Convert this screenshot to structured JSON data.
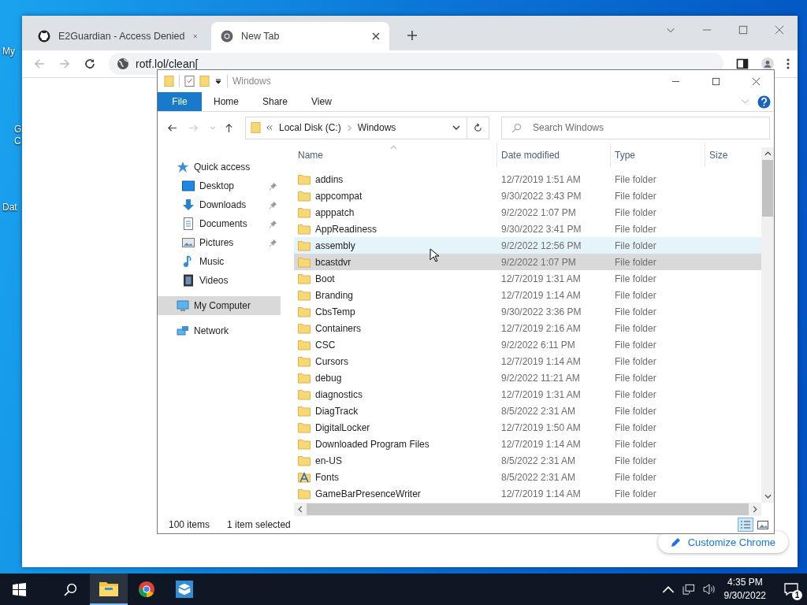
{
  "desktop_icons": [
    {
      "lines": [
        "My"
      ]
    },
    {
      "lines": [
        "G",
        "C"
      ]
    },
    {
      "lines": [
        "Dat"
      ]
    }
  ],
  "browser": {
    "tabs": [
      {
        "title": "E2Guardian - Access Denied",
        "selected": false
      },
      {
        "title": "New Tab",
        "selected": true
      }
    ],
    "address": "rotf.lol/clean[",
    "customize_button": "Customize Chrome"
  },
  "explorer": {
    "title": "Windows",
    "ribbon_tabs": [
      {
        "label": "File",
        "kind": "file"
      },
      {
        "label": "Home",
        "kind": "tab"
      },
      {
        "label": "Share",
        "kind": "tab"
      },
      {
        "label": "View",
        "kind": "tab"
      }
    ],
    "breadcrumb": [
      "Local Disk (C:)",
      "Windows"
    ],
    "search": {
      "placeholder": "Search Windows"
    },
    "nav": [
      {
        "label": "Quick access",
        "selected": false,
        "children": [
          {
            "label": "Desktop",
            "pinned": true,
            "selected": false
          },
          {
            "label": "Downloads",
            "pinned": true,
            "selected": false
          },
          {
            "label": "Documents",
            "pinned": true,
            "selected": false
          },
          {
            "label": "Pictures",
            "pinned": true,
            "selected": false
          },
          {
            "label": "Music",
            "pinned": false,
            "selected": false
          },
          {
            "label": "Videos",
            "pinned": false,
            "selected": false
          }
        ]
      },
      {
        "label": "My Computer",
        "selected": true
      },
      {
        "label": "Network",
        "selected": false
      }
    ],
    "columns": [
      "Name",
      "Date modified",
      "Type",
      "Size"
    ],
    "rows": [
      {
        "name": "addins",
        "date": "12/7/2019 1:51 AM",
        "type": "File folder",
        "kind": "folder",
        "selected": false,
        "hovered": false
      },
      {
        "name": "appcompat",
        "date": "9/30/2022 3:43 PM",
        "type": "File folder",
        "kind": "folder",
        "selected": false,
        "hovered": false
      },
      {
        "name": "apppatch",
        "date": "9/2/2022 1:07 PM",
        "type": "File folder",
        "kind": "folder",
        "selected": false,
        "hovered": false
      },
      {
        "name": "AppReadiness",
        "date": "9/30/2022 3:41 PM",
        "type": "File folder",
        "kind": "folder",
        "selected": false,
        "hovered": false
      },
      {
        "name": "assembly",
        "date": "9/2/2022 12:56 PM",
        "type": "File folder",
        "kind": "folder",
        "selected": false,
        "hovered": true
      },
      {
        "name": "bcastdvr",
        "date": "9/2/2022 1:07 PM",
        "type": "File folder",
        "kind": "folder",
        "selected": true,
        "hovered": false
      },
      {
        "name": "Boot",
        "date": "12/7/2019 1:31 AM",
        "type": "File folder",
        "kind": "folder",
        "selected": false,
        "hovered": false
      },
      {
        "name": "Branding",
        "date": "12/7/2019 1:14 AM",
        "type": "File folder",
        "kind": "folder",
        "selected": false,
        "hovered": false
      },
      {
        "name": "CbsTemp",
        "date": "9/30/2022 3:36 PM",
        "type": "File folder",
        "kind": "folder",
        "selected": false,
        "hovered": false
      },
      {
        "name": "Containers",
        "date": "12/7/2019 2:16 AM",
        "type": "File folder",
        "kind": "folder",
        "selected": false,
        "hovered": false
      },
      {
        "name": "CSC",
        "date": "9/2/2022 6:11 PM",
        "type": "File folder",
        "kind": "folder",
        "selected": false,
        "hovered": false
      },
      {
        "name": "Cursors",
        "date": "12/7/2019 1:14 AM",
        "type": "File folder",
        "kind": "folder",
        "selected": false,
        "hovered": false
      },
      {
        "name": "debug",
        "date": "9/2/2022 11:21 AM",
        "type": "File folder",
        "kind": "folder",
        "selected": false,
        "hovered": false
      },
      {
        "name": "diagnostics",
        "date": "12/7/2019 1:31 AM",
        "type": "File folder",
        "kind": "folder",
        "selected": false,
        "hovered": false
      },
      {
        "name": "DiagTrack",
        "date": "8/5/2022 2:31 AM",
        "type": "File folder",
        "kind": "folder",
        "selected": false,
        "hovered": false
      },
      {
        "name": "DigitalLocker",
        "date": "12/7/2019 1:50 AM",
        "type": "File folder",
        "kind": "folder",
        "selected": false,
        "hovered": false
      },
      {
        "name": "Downloaded Program Files",
        "date": "12/7/2019 1:14 AM",
        "type": "File folder",
        "kind": "folder",
        "selected": false,
        "hovered": false
      },
      {
        "name": "en-US",
        "date": "8/5/2022 2:31 AM",
        "type": "File folder",
        "kind": "folder",
        "selected": false,
        "hovered": false
      },
      {
        "name": "Fonts",
        "date": "8/5/2022 2:31 AM",
        "type": "File folder",
        "kind": "fonts",
        "selected": false,
        "hovered": false
      },
      {
        "name": "GameBarPresenceWriter",
        "date": "12/7/2019 1:14 AM",
        "type": "File folder",
        "kind": "folder",
        "selected": false,
        "hovered": false
      }
    ],
    "status": {
      "count": "100 items",
      "selection": "1 item selected"
    }
  },
  "taskbar": {
    "time": "4:35 PM",
    "date": "9/30/2022",
    "notifications": "1"
  }
}
